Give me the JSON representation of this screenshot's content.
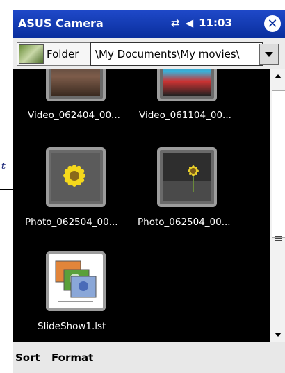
{
  "title_bar": {
    "app_name": "ASUS Camera",
    "time": "11:03",
    "icons": [
      "connectivity-icon",
      "volume-icon",
      "close-icon"
    ]
  },
  "toolbar": {
    "folder_label": "Folder",
    "path": "\\My Documents\\My movies\\"
  },
  "files": [
    {
      "name": "Video_062404_00...",
      "icon": "video-thumbnail"
    },
    {
      "name": "Video_061104_00...",
      "icon": "video-thumbnail"
    },
    {
      "name": "Photo_062504_00...",
      "icon": "photo-thumbnail"
    },
    {
      "name": "Photo_062504_00...",
      "icon": "photo-thumbnail"
    },
    {
      "name": "SlideShow1.lst",
      "icon": "slideshow-icon"
    }
  ],
  "menu": {
    "sort": "Sort",
    "format": "Format"
  },
  "callout": {
    "label": "t"
  },
  "colors": {
    "title_bar": "#0a2f9e",
    "content_bg": "#000000"
  }
}
